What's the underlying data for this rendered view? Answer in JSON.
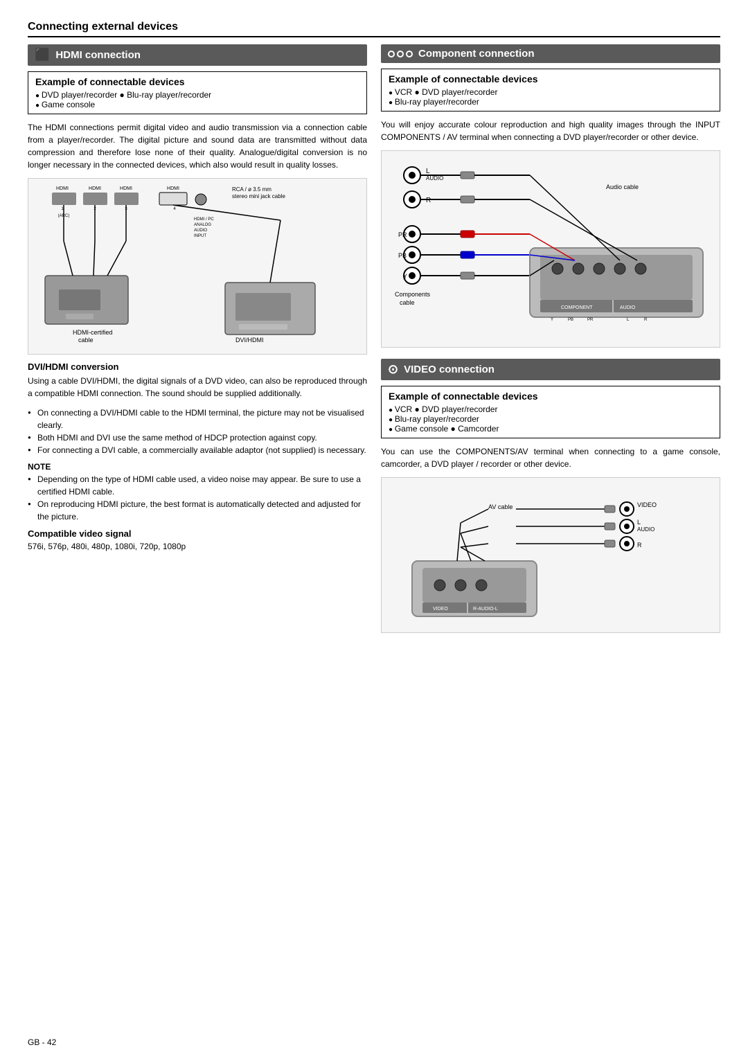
{
  "page": {
    "title": "Connecting external devices",
    "footer": "GB - 42"
  },
  "hdmi_section": {
    "header": "HDMI connection",
    "header_icon": "≡",
    "example_heading": "Example of connectable devices",
    "example_items": [
      "DVD player/recorder ● Blu-ray player/recorder",
      "Game console"
    ],
    "body1": "The HDMI connections permit digital video and audio transmission via a connection cable from a player/recorder. The digital picture and sound data are transmitted without data compression and therefore lose none of their quality. Analogue/digital conversion is no longer necessary in the connected devices, which also would result in quality losses.",
    "dvi_heading": "DVI/HDMI conversion",
    "dvi_body": "Using a cable DVI/HDMI, the digital signals of a DVD video, can also be reproduced through a compatible HDMI connection. The sound should be supplied additionally.",
    "dvi_bullets": [
      "On connecting a DVI/HDMI cable to the HDMI terminal, the picture may not be visualised clearly.",
      "Both HDMI and DVI use the same method of HDCP protection against copy.",
      "For connecting a DVI cable, a commercially available adaptor (not supplied) is necessary."
    ],
    "note_label": "NOTE",
    "note_bullets": [
      "Depending on the type of HDMI cable used, a video noise may appear. Be sure to use a certified HDMI cable.",
      "On reproducing HDMI picture, the best format is automatically detected and adjusted for the picture."
    ],
    "compatible_heading": "Compatible video signal",
    "compatible_text": "576i, 576p, 480i, 480p, 1080i, 720p, 1080p"
  },
  "component_section": {
    "header": "Component connection",
    "example_heading": "Example of connectable devices",
    "example_items": [
      "VCR ● DVD player/recorder",
      "Blu-ray player/recorder"
    ],
    "body": "You will enjoy accurate colour reproduction and high quality images through the INPUT COMPONENTS / AV terminal when connecting a DVD player/recorder or other device.",
    "diagram_labels": {
      "L": "L",
      "audio": "AUDIO",
      "R": "R",
      "audio_cable": "Audio cable",
      "PR": "PR",
      "PB": "PB",
      "Y": "Y",
      "components_cable": "Components\ncable"
    }
  },
  "video_section": {
    "header": "VIDEO connection",
    "example_heading": "Example of connectable devices",
    "example_items": [
      "VCR ● DVD player/recorder",
      "Blu-ray player/recorder",
      "Game console ● Camcorder"
    ],
    "body": "You can use the COMPONENTS/AV terminal when connecting to a game console, camcorder, a DVD player / recorder or other device.",
    "diagram_labels": {
      "av_cable": "AV cable",
      "video": "VIDEO",
      "L": "L",
      "audio": "AUDIO",
      "R": "R",
      "video_bottom": "VIDEO",
      "r_audio_l": "R-AUDIO-L"
    }
  }
}
